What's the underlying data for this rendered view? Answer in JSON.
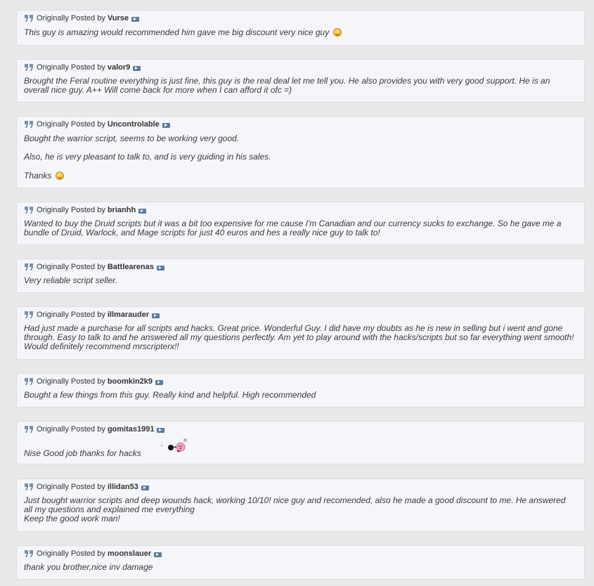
{
  "prefix": "Originally Posted by",
  "posts": [
    {
      "author": "Vurse",
      "lines": [
        "This guy is amazing would recommended him gave me big discount very nice guy"
      ]
    },
    {
      "author": "valor9",
      "lines": [
        "Brought the Feral routine everything is just fine, this guy is the real deal let me tell you. He also provides you with very good support. He is an",
        "overall nice guy. A++ Will come back for more when I can afford it ofc =)"
      ]
    },
    {
      "author": "Uncontrolable",
      "lines": [
        "Bought the warrior script, seems to be working very good.",
        "Also, he is very pleasant to talk to, and is very guiding in his sales.",
        "Thanks"
      ]
    },
    {
      "author": "brianhh",
      "lines": [
        "Wanted to buy the Druid scripts but it was a bit too expensive for me cause I'm Canadian and our currency sucks to exchange. So he gave me a",
        "bundle of Druid, Warlock, and Mage scripts for just 40 euros and hes a really nice guy to talk to!"
      ]
    },
    {
      "author": "Battlearenas",
      "lines": [
        "Very reliable script seller."
      ]
    },
    {
      "author": "illmarauder",
      "lines": [
        "Had just made a purchase for all scripts and hacks. Great price. Wonderful Guy. I did have my doubts as he is new in selling but i went and gone",
        "through. Easy to talk to and he answered all my questions perfectly. Am yet to play around with the hacks/scripts but so far everything went smooth!",
        "Would definitely recommend mrscripterx!!"
      ]
    },
    {
      "author": "boomkin2k9",
      "lines": [
        "Bought a few things from this guy. Really kind and helpful. High recommended"
      ]
    },
    {
      "author": "gomitas1991",
      "lines": [
        "Nise Good job thanks for hacks"
      ]
    },
    {
      "author": "illidan53",
      "lines": [
        "Just bought warrior scripts and deep wounds hack, working 10/10! nice guy and recomended, also he made a good discount to me. He answered",
        "all my questions and explained me everything",
        "Keep the good work man!"
      ]
    },
    {
      "author": "moonslauer",
      "lines": [
        "thank you brother,nice inv damage"
      ]
    }
  ],
  "icons": {
    "quote": "quote-icon",
    "view_post": "view-post-icon",
    "smiley": "smiley-icon",
    "sticker": "kirby-sticker-icon"
  },
  "colors": {
    "background": "#e9e9e9",
    "quote_bg": "#f5f6f9",
    "quote_border": "#dcdde2",
    "text": "#3a3a3a",
    "icon": "#5b7b9c"
  }
}
